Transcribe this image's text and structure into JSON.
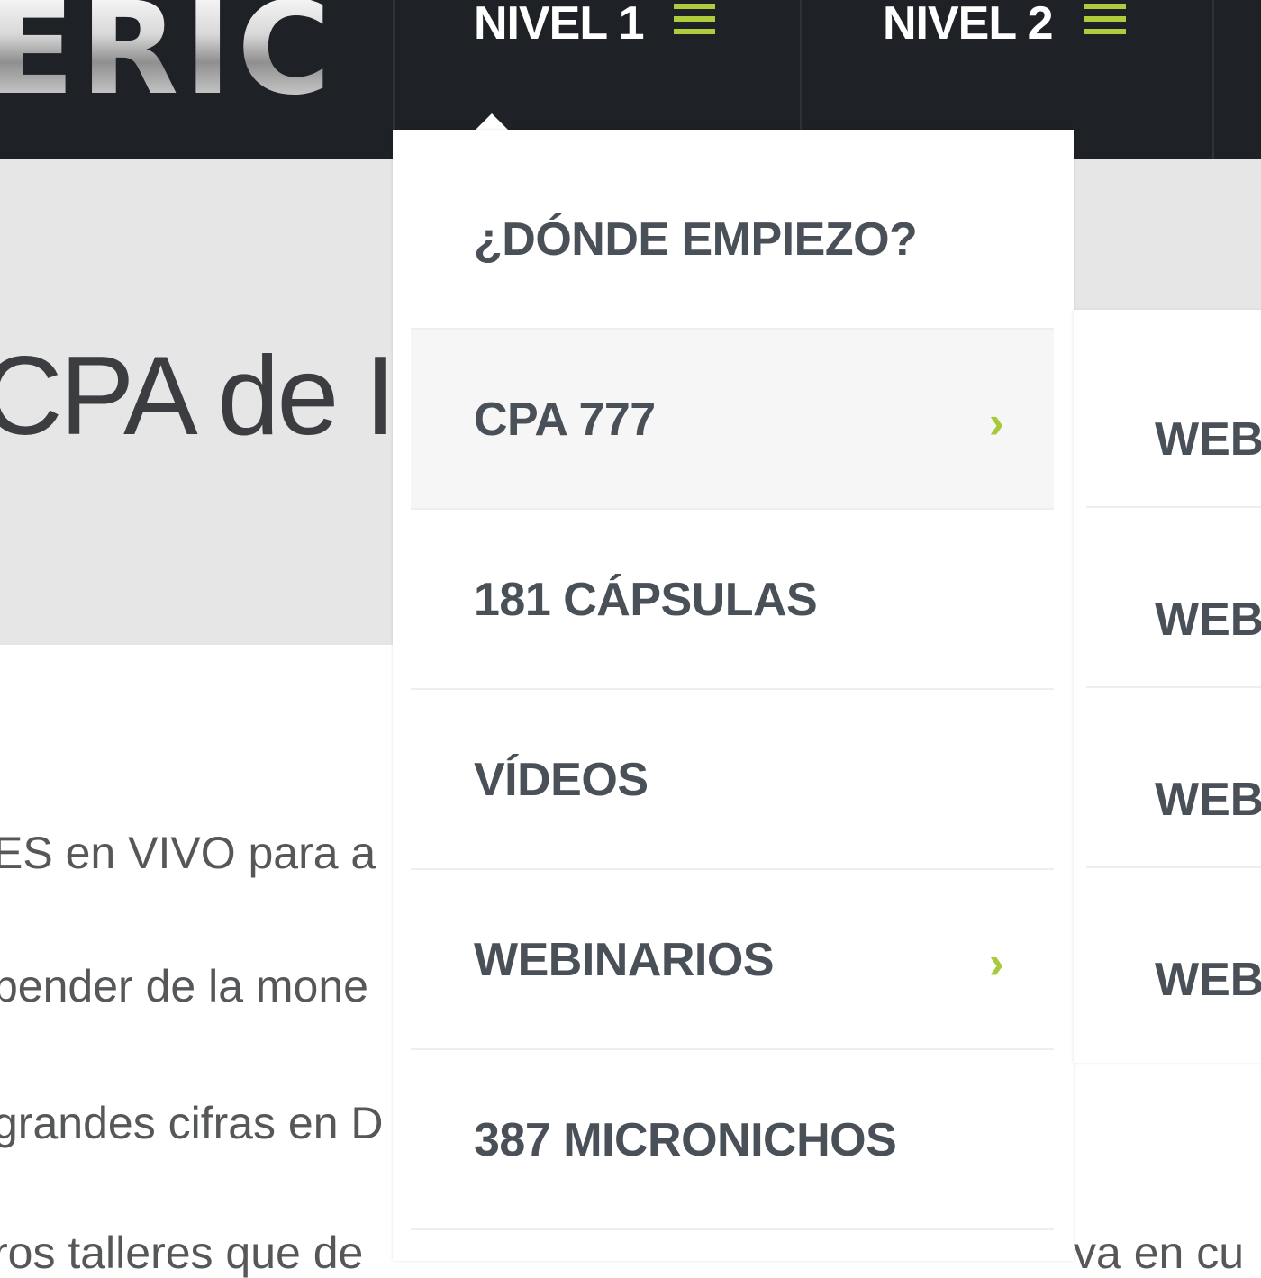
{
  "header": {
    "logo_text": "ERIC",
    "nav": [
      {
        "label": "NIVEL 1",
        "icon": "menu-icon"
      },
      {
        "label": "NIVEL 2",
        "icon": "menu-icon"
      }
    ]
  },
  "hero": {
    "title": "CPA de I"
  },
  "body_lines": [
    "ES en VIVO para a",
    "pender de la mone",
    "grandes cifras en D",
    "ros talleres que de"
  ],
  "body_line_right": "va en cu",
  "dropdown": {
    "items": [
      {
        "label": "¿DÓNDE EMPIEZO?",
        "has_submenu": false
      },
      {
        "label": "CPA 777",
        "has_submenu": true,
        "active": true
      },
      {
        "label": "181 CÁPSULAS",
        "has_submenu": false
      },
      {
        "label": "VÍDEOS",
        "has_submenu": false
      },
      {
        "label": "WEBINARIOS",
        "has_submenu": true
      },
      {
        "label": "387 MICRONICHOS",
        "has_submenu": false
      }
    ],
    "chevron": "›"
  },
  "submenu": {
    "items": [
      "WEB",
      "WEB",
      "WEB",
      "WEB"
    ]
  },
  "colors": {
    "nav_bg": "#1e2125",
    "accent": "#aecd3c",
    "menu_text": "#4a5058",
    "hero_bg": "#e6e6e6"
  }
}
